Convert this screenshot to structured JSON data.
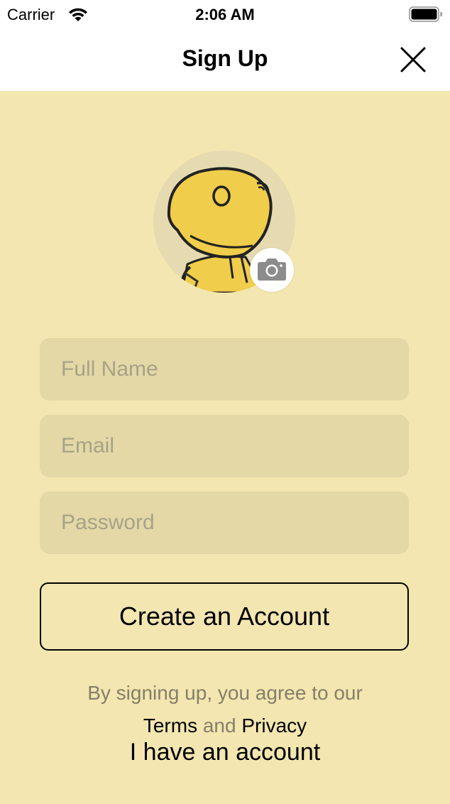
{
  "status_bar": {
    "carrier": "Carrier",
    "time": "2:06 AM",
    "icons": [
      "wifi-icon",
      "battery-icon"
    ]
  },
  "nav": {
    "title": "Sign Up",
    "close_icon": "close-icon"
  },
  "avatar": {
    "icon": "camera-icon"
  },
  "form": {
    "full_name": {
      "value": "",
      "placeholder": "Full Name"
    },
    "email": {
      "value": "",
      "placeholder": "Email"
    },
    "password": {
      "value": "",
      "placeholder": "Password"
    },
    "create_label": "Create an Account"
  },
  "legal": {
    "agree_text": "By signing up, you agree to our",
    "terms_label": "Terms",
    "and_label": "and",
    "privacy_label": "Privacy"
  },
  "have_account_label": "I have an account",
  "colors": {
    "background": "#f3e6b0",
    "field": "#e3d8a6",
    "avatar_yellow": "#f0cd4a"
  }
}
